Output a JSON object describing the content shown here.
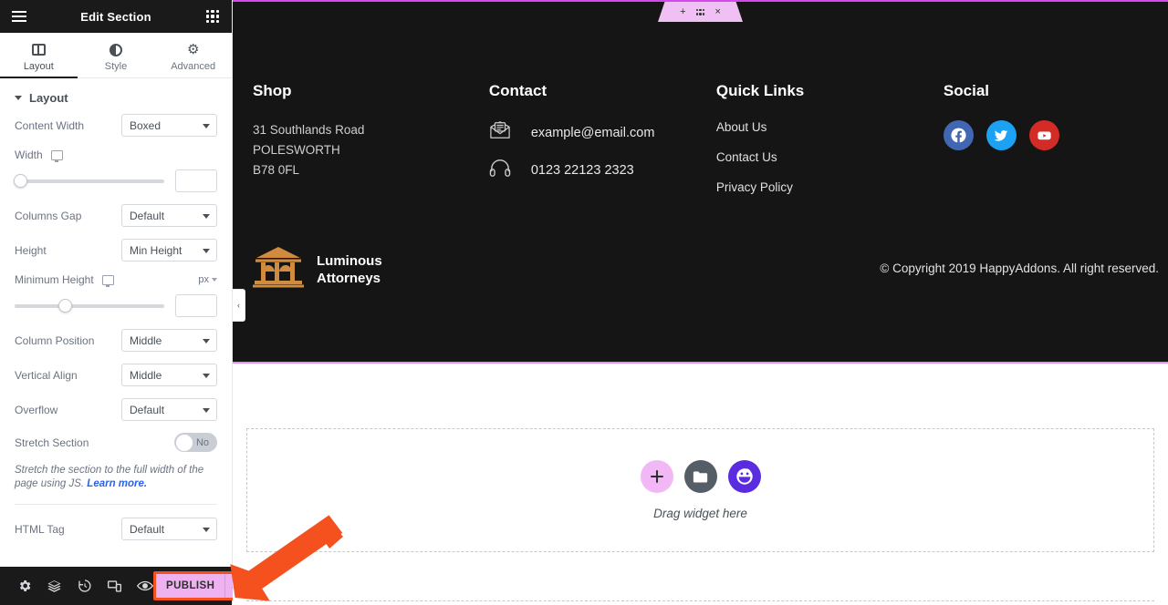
{
  "panel": {
    "header": {
      "title": "Edit Section",
      "menu_icon": "hamburger-menu-icon",
      "apps_icon": "apps-grid-icon"
    },
    "tabs": [
      {
        "label": "Layout",
        "icon": "layout-columns-icon",
        "active": true
      },
      {
        "label": "Style",
        "icon": "contrast-circle-icon",
        "active": false
      },
      {
        "label": "Advanced",
        "icon": "gear-icon",
        "active": false
      }
    ],
    "section": {
      "title": "Layout",
      "collapse_icon": "caret-down-icon"
    },
    "controls": [
      {
        "label": "Content Width",
        "value": "Boxed"
      },
      {
        "label": "Columns Gap",
        "value": "Default"
      },
      {
        "label": "Height",
        "value": "Min Height"
      },
      {
        "label": "Column Position",
        "value": "Middle"
      },
      {
        "label": "Vertical Align",
        "value": "Middle"
      },
      {
        "label": "Overflow",
        "value": "Default"
      },
      {
        "label": "HTML Tag",
        "value": "Default"
      }
    ],
    "width_slider": {
      "label": "Width",
      "device_icon": "desktop-icon",
      "value": "",
      "knob_percent": 0
    },
    "min_height_slider": {
      "label": "Minimum Height",
      "device_icon": "desktop-icon",
      "unit": "px",
      "value": "",
      "knob_percent": 29
    },
    "stretch": {
      "label": "Stretch Section",
      "toggle_value": "No"
    },
    "helper": {
      "text": "Stretch the section to the full width of the page using JS.",
      "link": "Learn more."
    },
    "footer_tools": [
      {
        "name": "settings-gear-icon",
        "glyph": "⚙"
      },
      {
        "name": "navigator-layers-icon",
        "glyph": "☰"
      },
      {
        "name": "history-revisions-icon",
        "glyph": "↺"
      },
      {
        "name": "responsive-mode-icon",
        "glyph": "❑"
      },
      {
        "name": "preview-eye-icon",
        "glyph": "◉"
      }
    ],
    "publish": {
      "label": "PUBLISH",
      "caret_icon": "chevron-up-icon",
      "background": "#eeb2f0",
      "highlight": "#f4511e"
    }
  },
  "collapse_handle": {
    "icon": "chevron-left-icon",
    "glyph": "‹"
  },
  "canvas": {
    "section_handle": {
      "add_icon": "plus-icon",
      "add_glyph": "+",
      "drag_icon": "drag-dots-icon",
      "close_icon": "close-x-icon",
      "close_glyph": "×",
      "background": "#f0c0f5"
    },
    "footer": {
      "background": "#151515",
      "columns": [
        {
          "heading": "Shop",
          "type": "address",
          "lines": [
            "31 Southlands Road",
            "POLESWORTH",
            "B78 0FL"
          ]
        },
        {
          "heading": "Contact",
          "type": "contact",
          "items": [
            {
              "icon": "envelope-mail-icon",
              "text": "example@email.com"
            },
            {
              "icon": "headset-support-icon",
              "text": "0123 22123 2323"
            }
          ]
        },
        {
          "heading": "Quick Links",
          "type": "links",
          "links": [
            "About Us",
            "Contact Us",
            "Privacy Policy"
          ]
        },
        {
          "heading": "Social",
          "type": "social",
          "socials": [
            {
              "icon": "facebook-icon",
              "color": "#4267b2"
            },
            {
              "icon": "twitter-icon",
              "color": "#1da1f2"
            },
            {
              "icon": "youtube-icon",
              "color": "#d32b26"
            }
          ]
        }
      ],
      "brand": {
        "logo_icon": "courthouse-scales-logo-icon",
        "logo_color": "#d08b3e",
        "name_line1": "Luminous",
        "name_line2": "Attorneys"
      },
      "copyright": "© Copyright 2019 HappyAddons. All right reserved."
    },
    "drop_zone": {
      "text": "Drag widget here",
      "buttons": [
        {
          "icon": "add-widget-plus-icon",
          "glyph": "+",
          "color": "#f2b8f5",
          "fg": "#2f2f2f"
        },
        {
          "icon": "template-folder-icon",
          "color": "#555d66",
          "fg": "#ffffff"
        },
        {
          "icon": "happyaddons-face-icon",
          "color": "#5b2be0",
          "fg": "#ffffff"
        }
      ]
    }
  },
  "annotation": {
    "arrow_icon": "pointer-arrow-icon",
    "color": "#f4511e",
    "points_to": "PUBLISH"
  }
}
